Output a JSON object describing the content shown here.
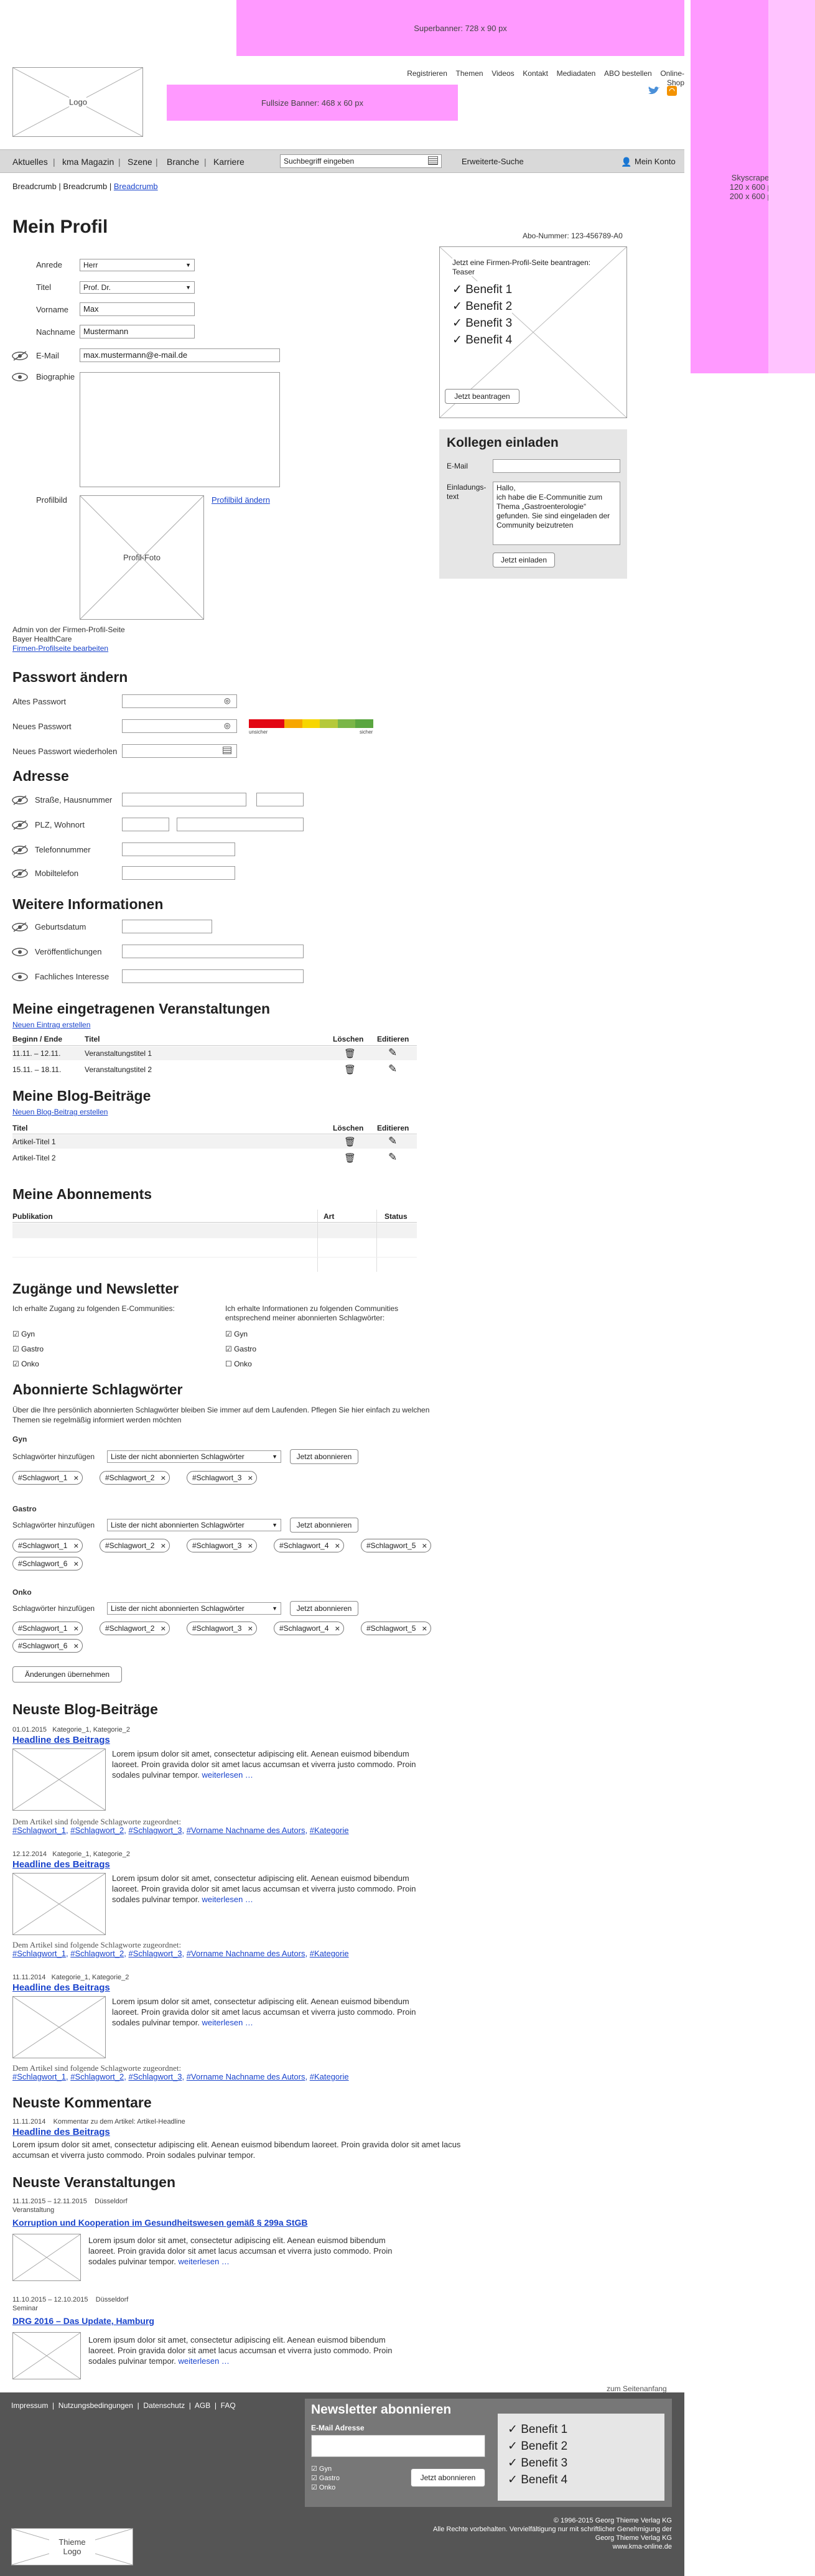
{
  "ads": {
    "superbanner": "Superbanner: 728 x 90 px",
    "fullsize": "Fullsize Banner: 468 x 60 px",
    "skyscraper": [
      "Skyscraper:",
      "120 x 600 px",
      "200 x 600 px"
    ]
  },
  "logo": "Logo",
  "topnav": [
    "Registrieren",
    "Themen",
    "Videos",
    "Kontakt",
    "Mediadaten",
    "ABO bestellen",
    "Online-Shop"
  ],
  "mainnav": {
    "items": [
      "Aktuelles",
      "kma Magazin",
      "Szene",
      "Branche",
      "Karriere"
    ],
    "search_placeholder": "Suchbegriff eingeben",
    "extended": "Erweiterte-Suche",
    "account": "Mein Konto"
  },
  "breadcrumb": {
    "a": "Breadcrumb",
    "b": "Breadcrumb",
    "c": "Breadcrumb"
  },
  "profile": {
    "title": "Mein Profil",
    "abo": "Abo-Nummer: 123-456789-A0",
    "anrede_label": "Anrede",
    "anrede": "Herr",
    "titel_label": "Titel",
    "titel": "Prof. Dr.",
    "vorname_label": "Vorname",
    "vorname": "Max",
    "nachname_label": "Nachname",
    "nachname": "Mustermann",
    "email_label": "E-Mail",
    "email": "max.mustermann@e-mail.de",
    "bio_label": "Biographie",
    "bild_label": "Profilbild",
    "foto": "Profil-Foto",
    "bild_change": "Profilbild ändern",
    "admin1": "Admin von der Firmen-Profil-Seite",
    "admin2": "Bayer HealthCare",
    "admin_link": "Firmen-Profilseite bearbeiten"
  },
  "teaser": {
    "text": [
      "Jetzt eine Firmen-Profil-Seite beantragen:",
      "Teaser"
    ],
    "benefits": [
      "Benefit 1",
      "Benefit 2",
      "Benefit 3",
      "Benefit 4"
    ],
    "button": "Jetzt beantragen"
  },
  "invite": {
    "title": "Kollegen einladen",
    "email_label": "E-Mail",
    "text_label": "Einladungs-\ntext",
    "text": "Hallo,\nich habe die E-Communitie zum Thema „Gastroenterologie“ gefunden. Sie sind eingeladen der Community beizutreten",
    "button": "Jetzt einladen"
  },
  "password": {
    "title": "Passwort ändern",
    "old": "Altes Passwort",
    "new": "Neues Passwort",
    "repeat": "Neues Passwort wiederholen",
    "weak": "unsicher",
    "strong": "sicher"
  },
  "address": {
    "title": "Adresse",
    "street": "Straße, Hausnummer",
    "plz": "PLZ, Wohnort",
    "phone": "Telefonnummer",
    "mobile": "Mobiltelefon"
  },
  "more": {
    "title": "Weitere Informationen",
    "birth": "Geburtsdatum",
    "pubs": "Veröffentlichungen",
    "interest": "Fachliches Interesse"
  },
  "events": {
    "title": "Meine eingetragenen Veranstaltungen",
    "new": "Neuen Eintrag erstellen",
    "h1": "Beginn / Ende",
    "h2": "Titel",
    "h3": "Löschen",
    "h4": "Editieren",
    "rows": [
      {
        "date": "11.11. – 12.11.",
        "title": "Veranstaltungstitel 1"
      },
      {
        "date": "15.11. – 18.11.",
        "title": "Veranstaltungstitel 2"
      }
    ]
  },
  "blogs": {
    "title": "Meine Blog-Beiträge",
    "new": "Neuen Blog-Beitrag erstellen",
    "h1": "Titel",
    "h2": "Löschen",
    "h3": "Editieren",
    "rows": [
      "Artikel-Titel 1",
      "Artikel-Titel 2"
    ]
  },
  "abos": {
    "title": "Meine Abonnements",
    "h1": "Publikation",
    "h2": "Art",
    "h3": "Status"
  },
  "access": {
    "title": "Zugänge und Newsletter",
    "left": "Ich erhalte Zugang zu folgenden E-Communities:",
    "right": "Ich erhalte Informationen zu folgenden Communities entsprechend meiner abonnierten Schlagwörter:",
    "left_items": [
      "Gyn",
      "Gastro",
      "Onko"
    ],
    "right_items": [
      "Gyn",
      "Gastro",
      "Onko"
    ]
  },
  "tags": {
    "title": "Abonnierte Schlagwörter",
    "intro": "Über die Ihre persönlich abonnierten Schlagwörter bleiben Sie immer auf dem Laufenden. Pflegen Sie hier einfach zu welchen Themen sie regelmäßig informiert werden möchten",
    "add_label": "Schlagwörter hinzufügen",
    "select": "Liste der nicht abonnierten Schlagwörter",
    "button": "Jetzt abonnieren",
    "groups": [
      {
        "name": "Gyn",
        "tags": [
          "#Schlagwort_1",
          "#Schlagwort_2",
          "#Schlagwort_3"
        ]
      },
      {
        "name": "Gastro",
        "tags": [
          "#Schlagwort_1",
          "#Schlagwort_2",
          "#Schlagwort_3",
          "#Schlagwort_4",
          "#Schlagwort_5",
          "#Schlagwort_6"
        ]
      },
      {
        "name": "Onko",
        "tags": [
          "#Schlagwort_1",
          "#Schlagwort_2",
          "#Schlagwort_3",
          "#Schlagwort_4",
          "#Schlagwort_5",
          "#Schlagwort_6"
        ]
      }
    ],
    "save": "Änderungen übernehmen"
  },
  "newblogs": {
    "title": "Neuste Blog-Beiträge",
    "posts": [
      {
        "date": "01.01.2015",
        "k1": "Kategorie_1",
        "k2": "Kategorie_2",
        "headline": "Headline des Beitrags",
        "text": "Lorem ipsum dolor sit amet, consectetur adipiscing elit. Aenean euismod bibendum laoreet. Proin gravida dolor sit amet lacus accumsan et viverra justo commodo. Proin sodales pulvinar tempor.",
        "more": "weiterlesen …"
      },
      {
        "date": "12.12.2014",
        "k1": "Kategorie_1",
        "k2": "Kategorie_2",
        "headline": "Headline des Beitrags",
        "text": "Lorem ipsum dolor sit amet, consectetur adipiscing elit. Aenean euismod bibendum laoreet. Proin gravida dolor sit amet lacus accumsan et viverra justo commodo. Proin sodales pulvinar tempor.",
        "more": "weiterlesen …"
      },
      {
        "date": "11.11.2014",
        "k1": "Kategorie_1",
        "k2": "Kategorie_2",
        "headline": "Headline des Beitrags",
        "text": "Lorem ipsum dolor sit amet, consectetur adipiscing elit. Aenean euismod bibendum laoreet. Proin gravida dolor sit amet lacus accumsan et viverra justo commodo. Proin sodales pulvinar tempor.",
        "more": "weiterlesen …"
      }
    ],
    "assigned": "Dem Artikel sind folgende Schlagworte zugeordnet:",
    "tl": [
      "#Schlagwort_1",
      "#Schlagwort_2",
      "#Schlagwort_3",
      "#Vorname Nachname des Autors",
      "#Kategorie"
    ]
  },
  "comments": {
    "title": "Neuste Kommentare",
    "date": "11.11.2014",
    "meta": "Kommentar zu dem Artikel: Artikel-Headline",
    "headline": "Headline des Beitrags",
    "text": "Lorem ipsum dolor sit amet, consectetur adipiscing elit. Aenean euismod bibendum laoreet. Proin gravida dolor sit amet lacus accumsan et viverra justo commodo. Proin sodales pulvinar tempor."
  },
  "newevents": {
    "title": "Neuste Veranstaltungen",
    "items": [
      {
        "date": "11.11.2015 – 12.11.2015",
        "place": "Düsseldorf",
        "type": "Veranstaltung",
        "headline": "Korruption und Kooperation im Gesundheitswesen gemäß § 299a StGB",
        "text": "Lorem ipsum dolor sit amet, consectetur adipiscing elit. Aenean euismod bibendum laoreet. Proin gravida dolor sit amet lacus accumsan et viverra justo commodo. Proin sodales pulvinar tempor.",
        "more": "weiterlesen …"
      },
      {
        "date": "11.10.2015 – 12.10.2015",
        "place": "Düsseldorf",
        "type": "Seminar",
        "headline": "DRG 2016 – Das Update, Hamburg",
        "text": "Lorem ipsum dolor sit amet, consectetur adipiscing elit. Aenean euismod bibendum laoreet. Proin gravida dolor sit amet lacus accumsan et viverra justo commodo. Proin sodales pulvinar tempor.",
        "more": "weiterlesen …"
      }
    ]
  },
  "totop": "zum Seitenanfang",
  "footer": {
    "links": [
      "Impressum",
      "Nutzungsbedingungen",
      "Datenschutz",
      "AGB",
      "FAQ"
    ],
    "nl_title": "Newsletter abonnieren",
    "nl_email": "E-Mail Adresse",
    "nl_items": [
      "Gyn",
      "Gastro",
      "Onko"
    ],
    "nl_button": "Jetzt abonnieren",
    "nl_benefits": [
      "Benefit 1",
      "Benefit 2",
      "Benefit 3",
      "Benefit 4"
    ],
    "copy1": "© 1996-2015 Georg Thieme Verlag KG",
    "copy2": "Alle Rechte vorbehalten. Vervielfältigung nur mit schriftlicher Genehmigung der",
    "copy3": "Georg Thieme Verlag KG",
    "copy4": "www.kma-online.de",
    "logo": "Thieme Logo"
  }
}
